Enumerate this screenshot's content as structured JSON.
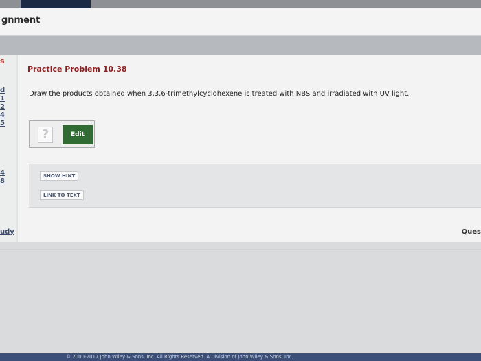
{
  "header": {
    "title": "gnment"
  },
  "sidebar": {
    "s_label": "s",
    "items": [
      "d",
      "1",
      "2",
      "4",
      "5",
      "4",
      "8"
    ]
  },
  "problem": {
    "title": "Practice Problem 10.38",
    "question": "Draw the products obtained when 3,3,6-trimethylcyclohexene is treated with NBS and irradiated with UV light."
  },
  "answer": {
    "placeholder_symbol": "?",
    "edit_label": "Edit"
  },
  "hints": {
    "show_hint_label": "SHOW HINT",
    "link_to_text_label": "LINK TO TEXT"
  },
  "bottom": {
    "study_label": "udy",
    "ques_label": "Ques"
  },
  "footer": {
    "text": "© 2000-2017 John Wiley & Sons, Inc. All Rights Reserved. A Division of John Wiley & Sons, Inc."
  },
  "colors": {
    "edit_button": "#2f6b33",
    "problem_title": "#8b1e1e",
    "footer_bg": "#3b4f78"
  }
}
